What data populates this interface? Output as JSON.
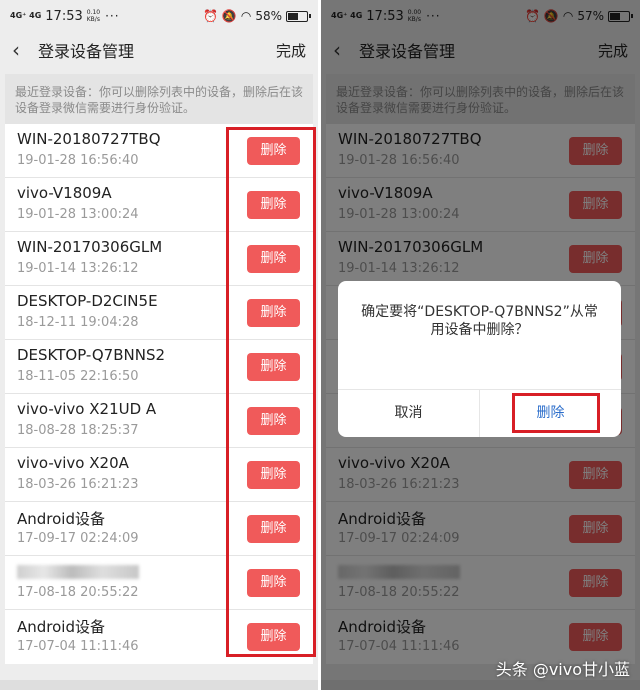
{
  "left": {
    "status": {
      "network": "4G⁺ 4G",
      "time": "17:53",
      "speed_top": "0.10",
      "speed_bottom": "KB/s",
      "dots": "···",
      "battery": "58%",
      "battery_level": 0.58
    },
    "nav": {
      "back": "‹",
      "title": "登录设备管理",
      "done": "完成"
    },
    "hint": "最近登录设备：你可以删除列表中的设备，删除后在该设备登录微信需要进行身份验证。",
    "delete_label": "删除",
    "devices": [
      {
        "name": "WIN-20180727TBQ",
        "time": "19-01-28 16:56:40"
      },
      {
        "name": "vivo-V1809A",
        "time": "19-01-28 13:00:24"
      },
      {
        "name": "WIN-20170306GLM",
        "time": "19-01-14 13:26:12"
      },
      {
        "name": "DESKTOP-D2CIN5E",
        "time": "18-12-11 19:04:28"
      },
      {
        "name": "DESKTOP-Q7BNNS2",
        "time": "18-11-05 22:16:50"
      },
      {
        "name": "vivo-vivo X21UD A",
        "time": "18-08-28 18:25:37"
      },
      {
        "name": "vivo-vivo X20A",
        "time": "18-03-26 16:21:23"
      },
      {
        "name": "Android设备",
        "time": "17-09-17 02:24:09"
      },
      {
        "name": "",
        "time": "17-08-18 20:55:22"
      },
      {
        "name": "Android设备",
        "time": "17-07-04 11:11:46"
      }
    ]
  },
  "right": {
    "status": {
      "network": "4G⁺ 4G",
      "time": "17:53",
      "speed_top": "0.00",
      "speed_bottom": "KB/s",
      "dots": "···",
      "battery": "57%",
      "battery_level": 0.57
    },
    "nav": {
      "back": "‹",
      "title": "登录设备管理",
      "done": "完成"
    },
    "hint": "最近登录设备：你可以删除列表中的设备，删除后在该设备登录微信需要进行身份验证。",
    "delete_label": "删除",
    "devices": [
      {
        "name": "WIN-20180727TBQ",
        "time": "19-01-28 16:56:40"
      },
      {
        "name": "vivo-V1809A",
        "time": "19-01-28 13:00:24"
      },
      {
        "name": "WIN-20170306GLM",
        "time": "19-01-14 13:26:12"
      },
      {
        "name": "",
        "time": ""
      },
      {
        "name": "",
        "time": ""
      },
      {
        "name": "V",
        "time": ""
      },
      {
        "name": "vivo-vivo X20A",
        "time": "18-03-26 16:21:23"
      },
      {
        "name": "Android设备",
        "time": "17-09-17 02:24:09"
      },
      {
        "name": "",
        "time": "17-08-18 20:55:22"
      },
      {
        "name": "Android设备",
        "time": "17-07-04 11:11:46"
      }
    ],
    "dialog": {
      "message": "确定要将“DESKTOP-Q7BNNS2”从常用设备中删除？",
      "cancel": "取消",
      "confirm": "删除"
    }
  },
  "watermark": "头条 @vivo甘小蓝",
  "colors": {
    "delete_button": "#f05a5a",
    "highlight": "#d81f26",
    "confirm_text": "#2c6ecb"
  }
}
